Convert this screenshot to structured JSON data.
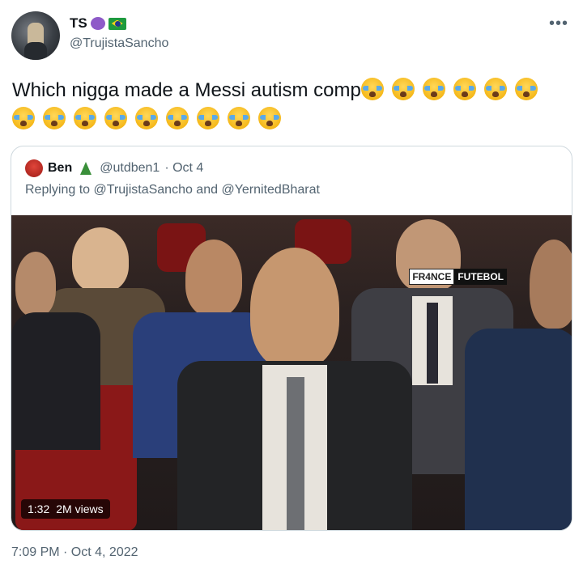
{
  "tweet": {
    "display_name": "TS",
    "handle": "@TrujistaSancho",
    "more_icon": "•••",
    "text": "Which nigga made a Messi autism comp",
    "emoji_count": 15,
    "timestamp": "7:09 PM · Oct 4, 2022"
  },
  "quoted": {
    "name": "Ben",
    "handle": "@utdben1",
    "date": "· Oct 4",
    "replying_to": "Replying to @TrujistaSancho and @YernitedBharat",
    "video": {
      "duration": "1:32",
      "views": "2M views",
      "watermark_a": "FR4NCE",
      "watermark_b": "FUTEBOL"
    }
  },
  "colors": {
    "secondary_text": "#536471",
    "border": "#cfd9de"
  }
}
